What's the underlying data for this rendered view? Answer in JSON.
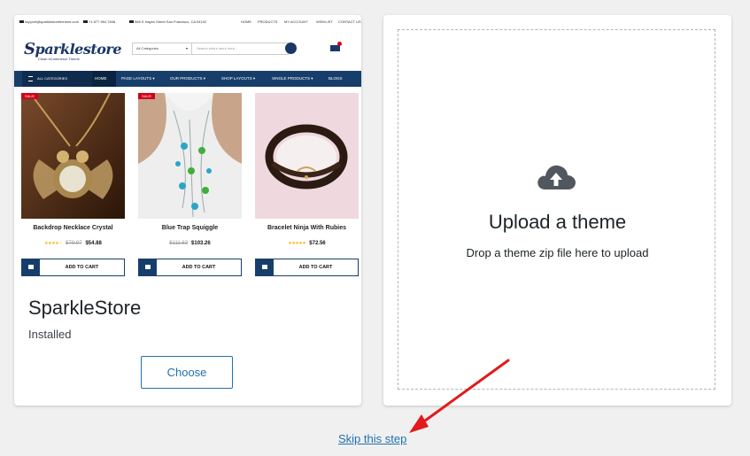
{
  "theme_card": {
    "preview": {
      "topbar": {
        "email": "support@sparklestorethemes.com",
        "phone": "+1 877 964 7848",
        "address": "968 S Hayes Street San Francisco, CA 94102",
        "links": [
          "HOME",
          "PRODUCTS",
          "MY ACCOUNT",
          "WISHLIST",
          "CONTACT US"
        ]
      },
      "logo": {
        "first": "S",
        "rest": "parklestore",
        "tagline": "Clean eCommerce Theme"
      },
      "search": {
        "category": "All Categories",
        "placeholder": "Search entire store here..."
      },
      "nav": {
        "all_categories": "ALL CATEGORIES",
        "items": [
          "HOME",
          "PAGE LAYOUTS ▾",
          "OUR PRODUCTS ▾",
          "SHOP LAYOUTS ▾",
          "SINGLE PRODUCTS ▾",
          "BLOGS"
        ]
      },
      "products": [
        {
          "name": "Backdrop Necklace Crystal",
          "sale": "SALE!",
          "stars": "★★★★☆",
          "old_price": "$79.97",
          "price": "$54.88",
          "add_to_cart": "ADD TO CART"
        },
        {
          "name": "Blue Trap Squiggle",
          "sale": "SALE!",
          "stars": "",
          "old_price": "$111.63",
          "price": "$103.26",
          "add_to_cart": "ADD TO CART"
        },
        {
          "name": "Bracelet Ninja With Rubies",
          "sale": "",
          "stars": "★★★★★",
          "old_price": "",
          "price": "$72.56",
          "add_to_cart": "ADD TO CART"
        }
      ]
    },
    "name": "SparkleStore",
    "status": "Installed",
    "choose_label": "Choose"
  },
  "upload": {
    "icon": "cloud-upload-icon",
    "title": "Upload a theme",
    "subtitle": "Drop a theme zip file here to upload"
  },
  "skip_label": "Skip this step",
  "colors": {
    "accent": "#2271b1",
    "page_bg": "#f0f0f1",
    "preview_nav": "#173e6b",
    "sale_badge": "#d0021b",
    "arrow": "#e3191c"
  }
}
